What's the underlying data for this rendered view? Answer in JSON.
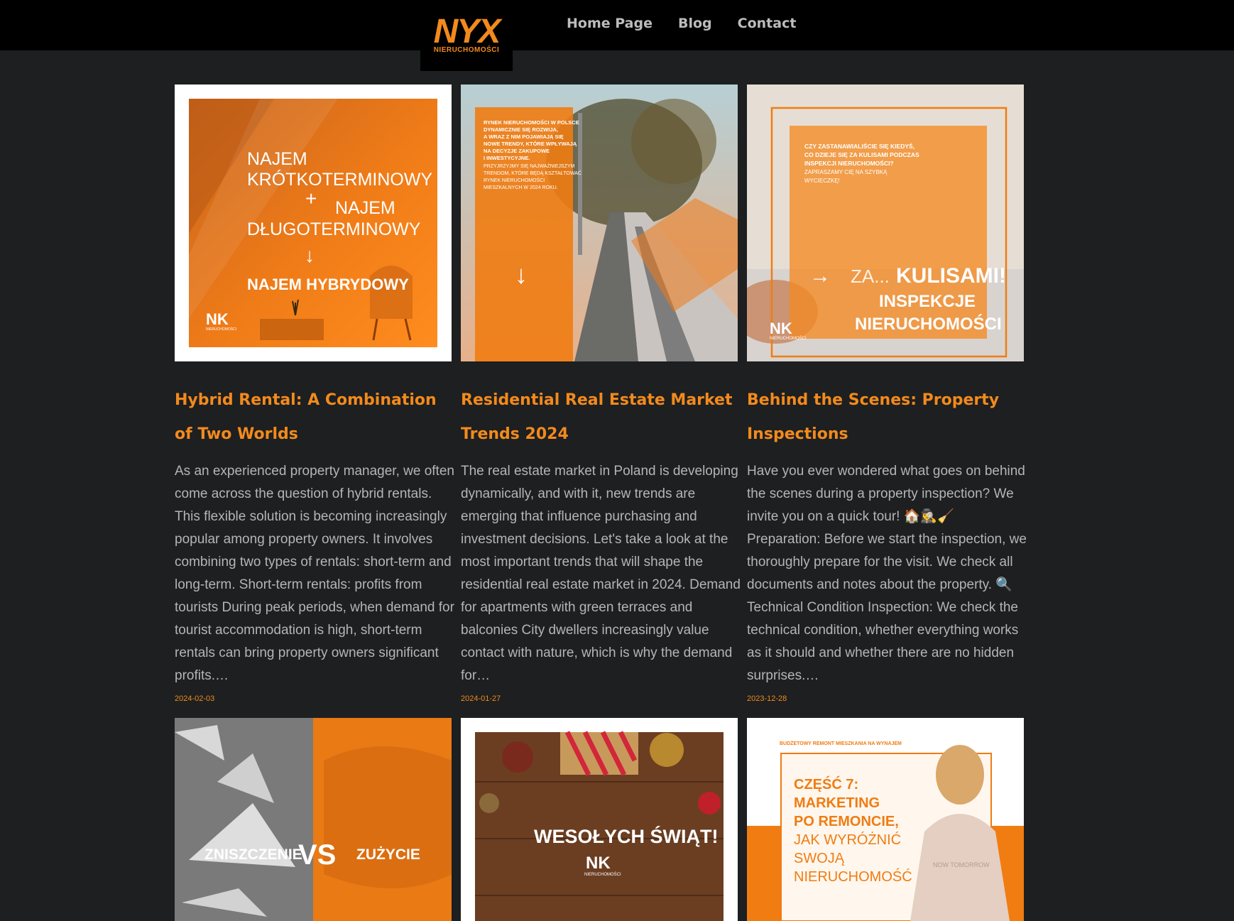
{
  "header": {
    "logo_text": "NYX",
    "logo_sub": "NIERUCHOMOŚCI",
    "nav": [
      "Home Page",
      "Blog",
      "Contact"
    ]
  },
  "colors": {
    "accent": "#f28a1d",
    "background": "#1d1f20",
    "header": "#000000"
  },
  "posts": [
    {
      "title": "Hybrid Rental: A Combination of Two Worlds",
      "excerpt": "As an experienced property manager, we often come across the question of hybrid rentals. This flexible solution is becoming increasingly popular among property owners. It involves combining two types of rentals: short-term and long-term. Short-term rentals: profits from tourists During peak periods, when demand for tourist accommodation is high, short-term rentals can bring property owners significant profits.…",
      "date": "2024-02-03",
      "image": {
        "line1": "NAJEM",
        "line2": "KRÓTKOTERMINOWY",
        "line3": "NAJEM",
        "line4": "DŁUGOTERMINOWY",
        "line5": "NAJEM HYBRYDOWY",
        "brand": "NIERUCHOMOŚCI"
      }
    },
    {
      "title": "Residential Real Estate Market Trends 2024",
      "excerpt": "The real estate market in Poland is developing dynamically, and with it, new trends are emerging that influence purchasing and investment decisions. Let's take a look at the most important trends that will shape the residential real estate market in 2024. Demand for apartments with green terraces and balconies City dwellers increasingly value contact with nature, which is why the demand for…",
      "date": "2024-01-27",
      "image": {
        "text_bold": "RYNEK NIERUCHOMOŚCI W POLSCE DYNAMICZNIE SIĘ ROZWIJA, A WRAZ Z NIM POJAWIAJĄ SIĘ NOWE TRENDY, KTÓRE WPŁYWAJĄ NA DECYZJE ZAKUPOWE I INWESTYCYJNE.",
        "text_light": "PRZYJRZYJMY SIĘ NAJWAŻNIEJSZYM TRENDOM, KTÓRE BĘDĄ KSZTAŁTOWAĆ RYNEK NIERUCHOMOŚCI MIESZKALNYCH W 2024 ROKU."
      }
    },
    {
      "title": "Behind the Scenes: Property Inspections",
      "excerpt": "Have you ever wondered what goes on behind the scenes during a property inspection? We invite you on a quick tour! 🏠🕵️‍♀️🧹 Preparation: Before we start the inspection, we thoroughly prepare for the visit. We check all documents and notes about the property. 🔍 Technical Condition Inspection: We check the technical condition, whether everything works as it should and whether there are no hidden surprises.…",
      "date": "2023-12-28",
      "image": {
        "text_bold": "CZY ZASTANAWIALIŚCIE SIĘ KIEDYŚ, CO DZIEJE SIĘ ZA KULISAMI PODCZAS INSPEKCJI NIERUCHOMOŚCI?",
        "text_light": "ZAPRASZAMY CIĘ NA SZYBKĄ WYCIECZKĘ!",
        "za": "ZA...",
        "kulisami": "KULISAMI!",
        "inspekcje": "INSPEKCJE",
        "nieruchomosci": "NIERUCHOMOŚCI",
        "brand": "NIERUCHOMOŚCI"
      }
    },
    {
      "image": {
        "left": "ZNISZCZENIE",
        "vs": "VS",
        "right": "ZUŻYCIE"
      }
    },
    {
      "image": {
        "greeting": "WESOŁYCH ŚWIĄT!",
        "brand": "NIERUCHOMOŚCI"
      }
    },
    {
      "image": {
        "top": "BUDŻETOWY REMONT MIESZKANIA NA WYNAJEM",
        "side": "BUDŻETOWY REMONT MIESZKANIA NA WYNAJEM",
        "l1": "CZĘŚĆ 7:",
        "l2": "MARKETING",
        "l3": "PO REMONCIE,",
        "l4": "JAK WYRÓŻNIĆ",
        "l5": "SWOJĄ",
        "l6": "NIERUCHOMOŚĆ",
        "shirt": "NOW TOMORROW"
      }
    }
  ]
}
